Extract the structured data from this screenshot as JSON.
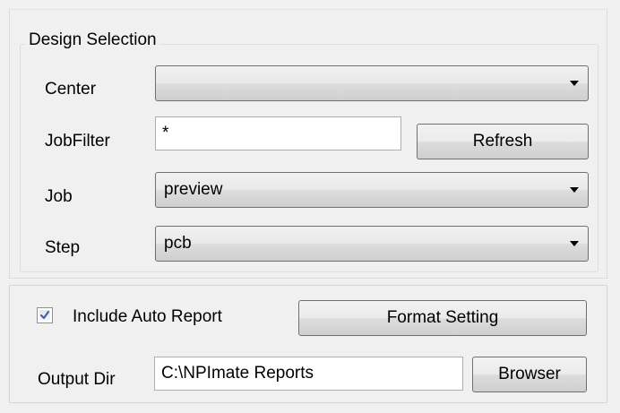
{
  "design_selection": {
    "title": "Design Selection",
    "center": {
      "label": "Center",
      "value": ""
    },
    "job_filter": {
      "label": "JobFilter",
      "value": "*"
    },
    "refresh_label": "Refresh",
    "job": {
      "label": "Job",
      "value": "preview"
    },
    "step": {
      "label": "Step",
      "value": "pcb"
    }
  },
  "report": {
    "include_auto_report": {
      "label": "Include Auto Report",
      "checked": true
    },
    "format_setting_label": "Format Setting",
    "output_dir": {
      "label": "Output Dir",
      "value": "C:\\NPImate Reports"
    },
    "browser_label": "Browser"
  },
  "icons": {
    "checkbox_mark": "checkmark-icon",
    "dropdown": "chevron-down-icon"
  }
}
